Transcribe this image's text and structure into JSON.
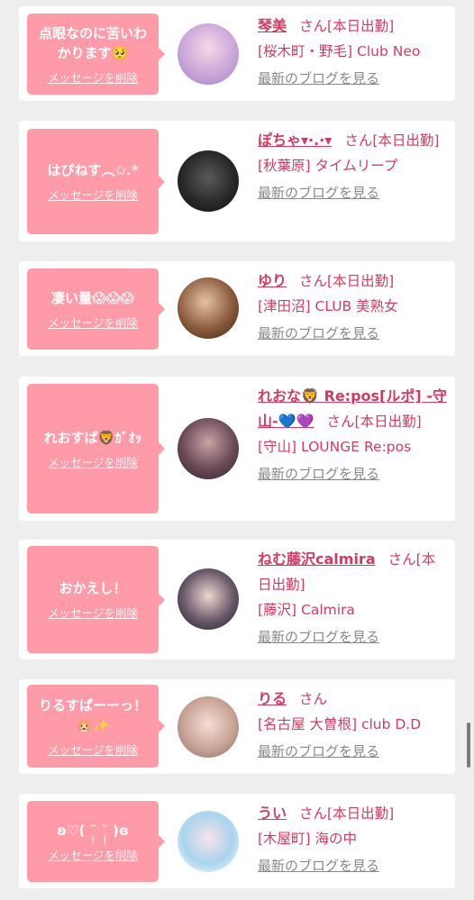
{
  "colors": {
    "page_background": "#eeeeee",
    "card_background": "#ffffff",
    "bubble_pink": "#ff9aa8",
    "name_pink": "#d63a63",
    "link_gray": "#888888"
  },
  "labels": {
    "delete_message": "メッセージを削除",
    "latest_blog": "最新のブログを見る",
    "san": "さん"
  },
  "cards": [
    {
      "message": "点眼なのに苦いわかります🥺",
      "name": "琴美",
      "status": "[本日出勤]",
      "shop": "[桜木町・野毛] Club Neo"
    },
    {
      "message": "はぴねす︵✩.*",
      "name": "ぽちゃ▾·.·▾",
      "status": "[本日出勤]",
      "shop": "[秋葉原] タイムリープ"
    },
    {
      "message": "凄い量😱😱😱",
      "name": "ゆり",
      "status": "[本日出勤]",
      "shop": "[津田沼] CLUB 美熟女"
    },
    {
      "message": "れおすぱ🦁ｶﾞｵｯ",
      "name": "れおな🦁 Re:pos[ルポ] -守山-💙💜",
      "status": "[本日出勤]",
      "shop": "[守山] LOUNGE Re:pos"
    },
    {
      "message": "おかえし！",
      "name": "ねむ藤沢calmira",
      "status": "[本日出勤]",
      "shop": "[藤沢] Calmira"
    },
    {
      "message": "りるすぱーーっ！🐹✨",
      "name": "りる",
      "status": "",
      "shop": "[名古屋 大曽根] club D.D"
    },
    {
      "message": "ʚ♡(  ˘̩̩̩ ˘̩̩̩ )ɞ",
      "name": "うい",
      "status": "[本日出勤]",
      "shop": "[木屋町] 海の中"
    }
  ]
}
